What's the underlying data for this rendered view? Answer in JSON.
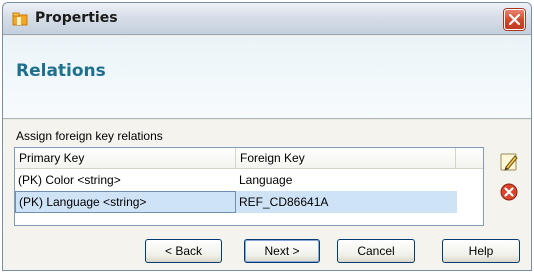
{
  "window": {
    "title": "Properties",
    "icons": {
      "app": "folder-icon",
      "close": "close-icon"
    }
  },
  "header": {
    "title": "Relations"
  },
  "main": {
    "label": "Assign foreign key relations",
    "table": {
      "columns": [
        "Primary Key",
        "Foreign Key"
      ],
      "rows": [
        {
          "primary_key": "(PK) Color <string>",
          "foreign_key": "Language"
        },
        {
          "primary_key": "(PK) Language <string>",
          "foreign_key": "REF_CD86641A",
          "selected": true
        }
      ]
    },
    "side_buttons": {
      "edit": "edit-icon",
      "delete": "delete-icon"
    }
  },
  "buttons": {
    "back": "< Back",
    "next": "Next >",
    "cancel": "Cancel",
    "help": "Help"
  },
  "colors": {
    "header_title": "#1f6f8f",
    "selection": "#cfe3f6",
    "close": "#d0472b"
  }
}
